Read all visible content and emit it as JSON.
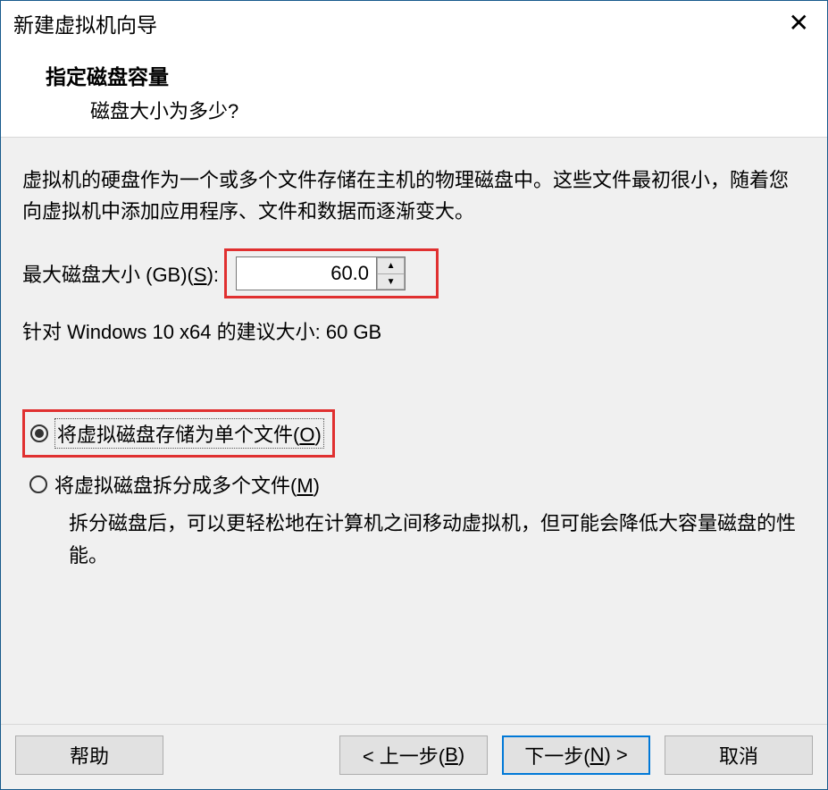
{
  "window": {
    "title": "新建虚拟机向导"
  },
  "page": {
    "heading": "指定磁盘容量",
    "subheading": "磁盘大小为多少?"
  },
  "intro": "虚拟机的硬盘作为一个或多个文件存储在主机的物理磁盘中。这些文件最初很小，随着您向虚拟机中添加应用程序、文件和数据而逐渐变大。",
  "disk": {
    "label_prefix": "最大磁盘大小 (GB)(",
    "label_key": "S",
    "label_suffix": "):",
    "value": "60.0",
    "recommend": "针对 Windows 10 x64 的建议大小: 60 GB"
  },
  "options": {
    "single_prefix": "将虚拟磁盘存储为单个文件(",
    "single_key": "O",
    "single_suffix": ")",
    "split_prefix": "将虚拟磁盘拆分成多个文件(",
    "split_key": "M",
    "split_suffix": ")",
    "split_note": "拆分磁盘后，可以更轻松地在计算机之间移动虚拟机，但可能会降低大容量磁盘的性能。"
  },
  "buttons": {
    "help": "帮助",
    "back_prefix": "< 上一步(",
    "back_key": "B",
    "back_suffix": ")",
    "next_prefix": "下一步(",
    "next_key": "N",
    "next_suffix": ") >",
    "cancel": "取消"
  }
}
